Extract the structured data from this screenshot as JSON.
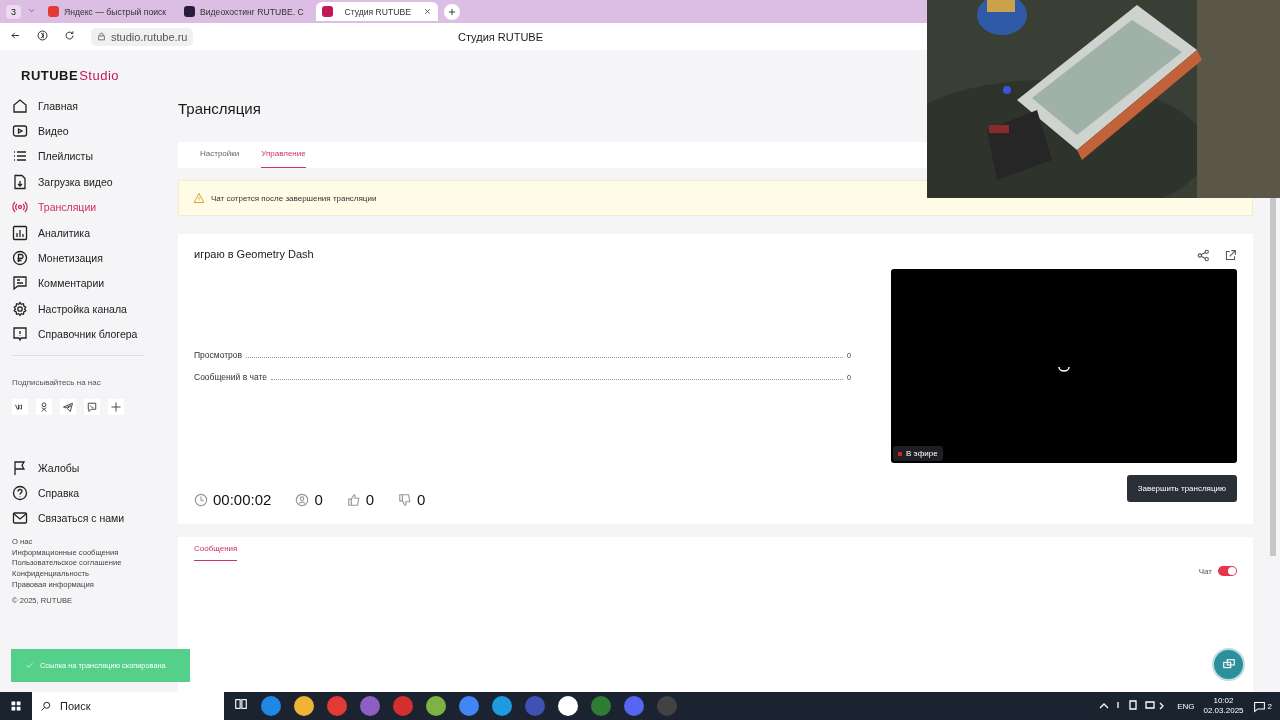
{
  "browser": {
    "tab_count": "3",
    "tabs": [
      {
        "title": "Яндекс — быстрый поиск",
        "selected": false
      },
      {
        "title": "Видеохостинг RUTUBE. С",
        "selected": false
      },
      {
        "title": "Студия RUTUBE",
        "selected": true
      }
    ],
    "url": "studio.rutube.ru",
    "page_title": "Студия RUTUBE"
  },
  "sidebar": {
    "logo": "RUTUBE",
    "logo_suffix": "Studio",
    "items": [
      {
        "label": "Главная",
        "selected": false
      },
      {
        "label": "Видео",
        "selected": false
      },
      {
        "label": "Плейлисты",
        "selected": false
      },
      {
        "label": "Загрузка видео",
        "selected": false
      },
      {
        "label": "Трансляции",
        "selected": true
      },
      {
        "label": "Аналитика",
        "selected": false
      },
      {
        "label": "Монетизация",
        "selected": false
      },
      {
        "label": "Комментарии",
        "selected": false
      },
      {
        "label": "Настройка канала",
        "selected": false
      },
      {
        "label": "Справочник блогера",
        "selected": false
      }
    ],
    "follow_label": "Подписывайтесь на нас",
    "bottom_items": [
      {
        "label": "Жалобы"
      },
      {
        "label": "Справка"
      },
      {
        "label": "Связаться с нами"
      }
    ],
    "links": [
      "О нас",
      "Информационные сообщения",
      "Пользовательское соглашение",
      "Конфиденциальность",
      "Правовая информация"
    ],
    "copyright": "© 2025, RUTUBE"
  },
  "page_title": "Трансляция",
  "tabs": [
    {
      "label": "Настройки",
      "selected": false
    },
    {
      "label": "Управление",
      "selected": true
    }
  ],
  "warning": "Чат сотрется после завершения трансляции",
  "stream": {
    "title": "играю в Geometry Dash",
    "stats": [
      {
        "label": "Просмотров",
        "value": "0"
      },
      {
        "label": "Сообщений в чате",
        "value": "0"
      }
    ],
    "counters": [
      {
        "kind": "timer",
        "value": "00:00:02"
      },
      {
        "kind": "viewers",
        "value": "0"
      },
      {
        "kind": "likes",
        "value": "0"
      },
      {
        "kind": "dislikes",
        "value": "0"
      }
    ],
    "live_badge": "В эфире",
    "end_button": "Завершить трансляцию"
  },
  "chat": {
    "tabs": [
      {
        "label": "Сообщения",
        "selected": true
      }
    ],
    "toggle_label": "Чат",
    "toggle_on": true
  },
  "toast": "Ссылка на трансляцию скопирована",
  "taskbar": {
    "search": "Поиск",
    "language": "ENG",
    "time": "10:02",
    "date": "02.03.2025",
    "notifications": "2"
  }
}
